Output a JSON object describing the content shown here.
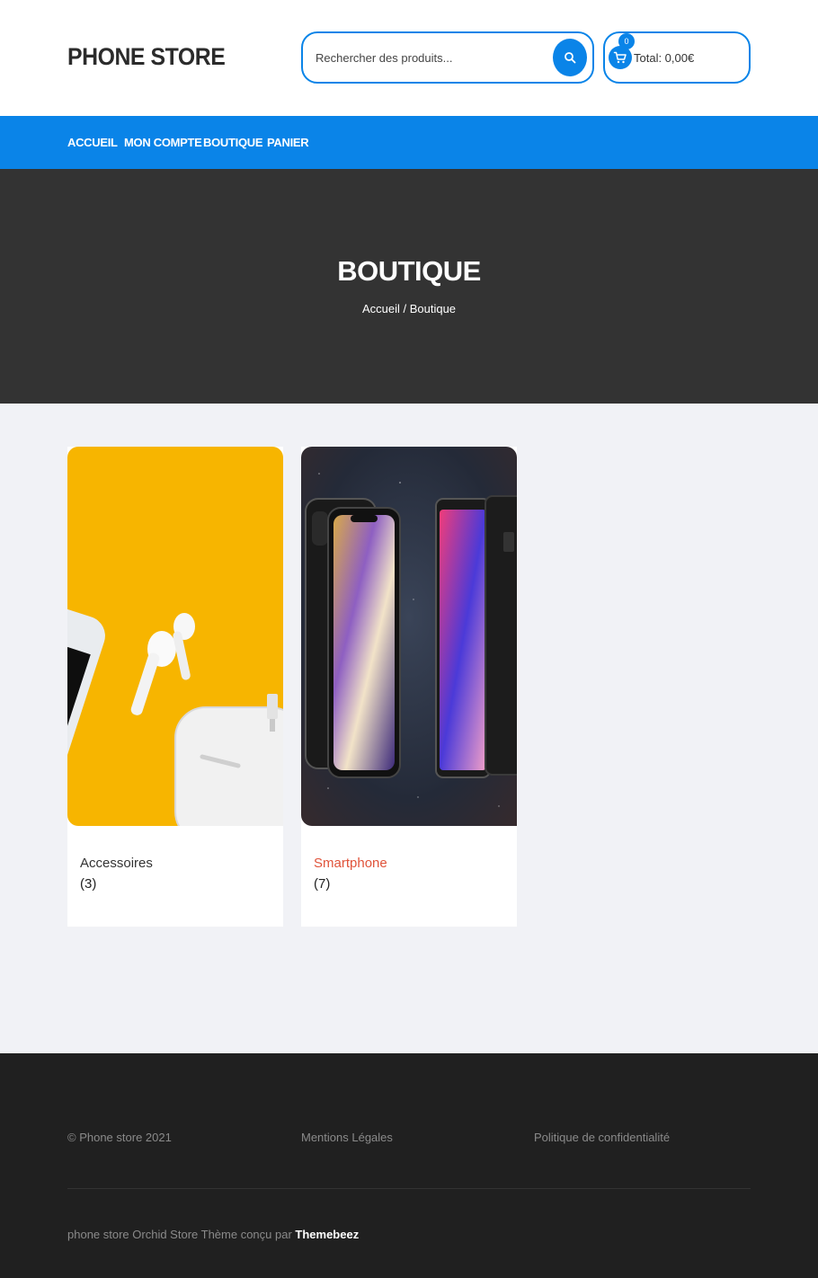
{
  "header": {
    "logo": "PHONE STORE",
    "search_placeholder": "Rechercher des produits...",
    "cart_count": "0",
    "cart_total": "Total: 0,00€"
  },
  "nav": {
    "items": [
      "ACCUEIL",
      "MON COMPTE",
      "BOUTIQUE",
      "PANIER"
    ]
  },
  "hero": {
    "title": "BOUTIQUE",
    "breadcrumb_home": "Accueil",
    "breadcrumb_sep": " / ",
    "breadcrumb_current": "Boutique"
  },
  "categories": [
    {
      "name": "Accessoires",
      "count": "(3)",
      "color": "#333333"
    },
    {
      "name": "Smartphone",
      "count": "(7)",
      "color": "#e0533a"
    }
  ],
  "footer": {
    "copyright": "© Phone store 2021",
    "legal": "Mentions Légales",
    "privacy": "Politique de confidentialité",
    "credit_prefix": "phone store Orchid Store Thème conçu par ",
    "credit_link": "Themebeez"
  },
  "colors": {
    "accent": "#0a84e8",
    "hero_bg": "#333333",
    "footer_bg": "#202020",
    "page_bg": "#f1f2f6"
  }
}
